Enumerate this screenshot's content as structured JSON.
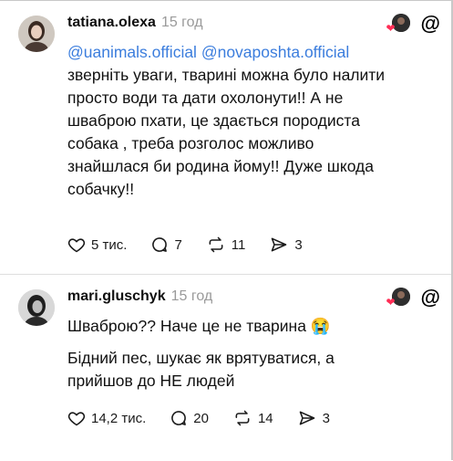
{
  "posts": [
    {
      "username": "tatiana.olexa",
      "time": "15 год",
      "mention1": "@uanimals.official",
      "mention2": "@novaposhta.official",
      "text1": "зверніть уваги, тварині можна було налити",
      "text2": "просто води та дати охолонути!! А не",
      "text3": "шваброю пхати, це здається породиста",
      "text4": "собака , треба розголос можливо",
      "text5": "знайшлася би родина йому!! Дуже шкода",
      "text6": "собачку!!",
      "likes": "5 тис.",
      "comments": "7",
      "reposts": "11",
      "shares": "3"
    },
    {
      "username": "mari.gluschyk",
      "time": "15 год",
      "text1": "Шваброю?? Наче це не тварина 😭",
      "text2": "Бідний пес, шукає як врятуватися, а",
      "text3": "прийшов до НЕ людей",
      "likes": "14,2 тис.",
      "comments": "20",
      "reposts": "14",
      "shares": "3"
    }
  ],
  "icons": [
    "heart-outline-icon",
    "comment-bubble-icon",
    "repost-icon",
    "share-paper-plane-icon",
    "threads-logo-icon",
    "liked-heart-icon"
  ],
  "colors": {
    "mention": "#3b7ddd",
    "time": "#9a9a9a",
    "heart": "#ff2d55"
  }
}
